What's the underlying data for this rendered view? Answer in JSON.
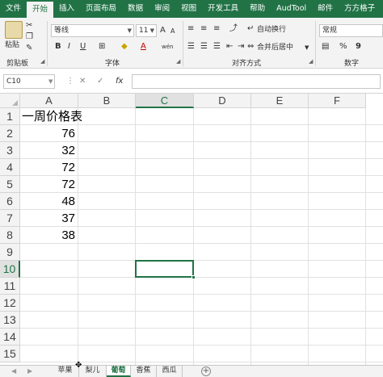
{
  "ribbon_tabs": [
    "文件",
    "开始",
    "插入",
    "页面布局",
    "数据",
    "审阅",
    "视图",
    "开发工具",
    "帮助",
    "AudTool",
    "邮件",
    "方方格子"
  ],
  "active_ribbon_tab": "开始",
  "clipboard": {
    "paste_label": "粘贴",
    "group_label": "剪贴板"
  },
  "font": {
    "name": "等线",
    "size": "11",
    "bold": "B",
    "italic": "I",
    "underline": "U",
    "grow": "A",
    "shrink": "A",
    "font_color_glyph": "A",
    "group_label": "字体",
    "phonetic": "wén"
  },
  "alignment": {
    "wrap_text": "自动换行",
    "merge_center": "合并后居中",
    "group_label": "对齐方式"
  },
  "number": {
    "format": "常规",
    "percent": "%",
    "comma": "9",
    "group_label": "数字"
  },
  "formula_bar": {
    "name_box": "C10",
    "cancel": "✕",
    "enter": "✓",
    "fx": "fx",
    "value": ""
  },
  "columns": [
    "A",
    "B",
    "C",
    "D",
    "E",
    "F"
  ],
  "selected_column": "C",
  "rows": [
    "1",
    "2",
    "3",
    "4",
    "5",
    "6",
    "7",
    "8",
    "9",
    "10",
    "11",
    "12",
    "13",
    "14",
    "15"
  ],
  "selected_row": "10",
  "cells": {
    "A1": "一周价格表",
    "A2": "76",
    "A3": "32",
    "A4": "72",
    "A5": "72",
    "A6": "48",
    "A7": "37",
    "A8": "38"
  },
  "sheet_tabs": [
    "苹果",
    "梨儿",
    "葡萄",
    "香蕉",
    "西瓜"
  ],
  "active_sheet": "葡萄",
  "colors": {
    "accent": "#217346",
    "ribbon_bg": "#f3f3f3",
    "grid_line": "#e1e1e1"
  }
}
